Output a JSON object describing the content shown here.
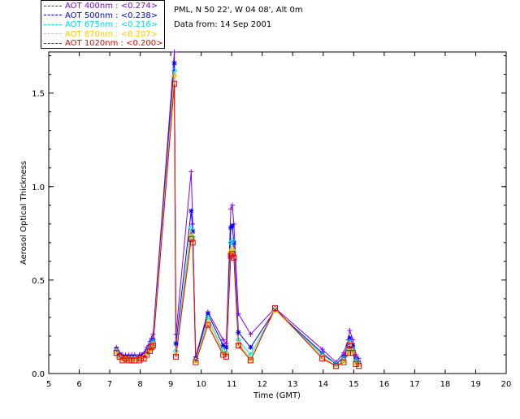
{
  "info": {
    "location": "PML, N 50 22', W 04 08', Alt 0m",
    "date": "Data from: 14 Sep 2001"
  },
  "chart_data": {
    "type": "line",
    "xlabel": "Time (GMT)",
    "ylabel": "Aerosol Optical Thickness",
    "xlim": [
      5,
      20
    ],
    "ylim": [
      0,
      1.72
    ],
    "xticks": [
      "5",
      "6",
      "7",
      "8",
      "9",
      "10",
      "11",
      "12",
      "13",
      "14",
      "15",
      "16",
      "17",
      "18",
      "19",
      "20"
    ],
    "yticks": [
      {
        "v": 0.0,
        "label": "0.0"
      },
      {
        "v": 0.5,
        "label": "0.5"
      },
      {
        "v": 1.0,
        "label": "1.0"
      },
      {
        "v": 1.5,
        "label": "1.5"
      }
    ],
    "x": [
      7.22,
      7.32,
      7.42,
      7.52,
      7.62,
      7.72,
      7.82,
      7.97,
      8.02,
      8.12,
      8.22,
      8.32,
      8.37,
      8.42,
      9.12,
      9.17,
      9.67,
      9.72,
      9.82,
      10.22,
      10.72,
      10.82,
      10.97,
      11.02,
      11.07,
      11.22,
      11.62,
      12.42,
      13.97,
      14.42,
      14.67,
      14.82,
      14.87,
      14.97,
      15.07,
      15.17
    ],
    "series": [
      {
        "name": "AOT  400nm : <0.274>",
        "color": "#7f00ff",
        "marker": "plus",
        "values": [
          0.14,
          0.11,
          0.1,
          0.1,
          0.1,
          0.1,
          0.1,
          0.1,
          0.1,
          0.11,
          0.14,
          0.17,
          0.19,
          0.21,
          1.72,
          0.21,
          1.08,
          0.8,
          0.09,
          0.33,
          0.18,
          0.16,
          0.88,
          0.9,
          0.8,
          0.32,
          0.21,
          0.35,
          0.13,
          0.06,
          0.11,
          0.18,
          0.23,
          0.18,
          0.1,
          0.08
        ]
      },
      {
        "name": "AOT  500nm : <0.238>",
        "color": "#0000ff",
        "marker": "star",
        "values": [
          0.13,
          0.1,
          0.09,
          0.09,
          0.09,
          0.09,
          0.09,
          0.09,
          0.09,
          0.1,
          0.12,
          0.15,
          0.17,
          0.18,
          1.66,
          0.16,
          0.87,
          0.76,
          0.08,
          0.32,
          0.15,
          0.14,
          0.78,
          0.79,
          0.7,
          0.22,
          0.14,
          0.34,
          0.11,
          0.05,
          0.09,
          0.15,
          0.19,
          0.15,
          0.08,
          0.06
        ]
      },
      {
        "name": "AOT  675nm : <0.216>",
        "color": "#00dcdc",
        "marker": "diamond",
        "values": [
          0.12,
          0.09,
          0.08,
          0.08,
          0.08,
          0.08,
          0.08,
          0.08,
          0.08,
          0.09,
          0.11,
          0.14,
          0.16,
          0.17,
          1.62,
          0.12,
          0.78,
          0.73,
          0.07,
          0.3,
          0.12,
          0.11,
          0.7,
          0.71,
          0.65,
          0.18,
          0.1,
          0.34,
          0.1,
          0.05,
          0.08,
          0.13,
          0.17,
          0.13,
          0.07,
          0.05
        ]
      },
      {
        "name": "AOT  870nm : <0.207>",
        "color": "#ffc800",
        "marker": "triangle",
        "values": [
          0.12,
          0.09,
          0.08,
          0.08,
          0.08,
          0.08,
          0.08,
          0.08,
          0.08,
          0.09,
          0.11,
          0.13,
          0.15,
          0.16,
          1.6,
          0.1,
          0.75,
          0.72,
          0.07,
          0.28,
          0.11,
          0.1,
          0.66,
          0.67,
          0.63,
          0.16,
          0.08,
          0.34,
          0.09,
          0.04,
          0.07,
          0.12,
          0.16,
          0.12,
          0.06,
          0.05
        ]
      },
      {
        "name": "AOT 1020nm : <0.200>",
        "color": "#e60000",
        "marker": "square",
        "values": [
          0.11,
          0.09,
          0.07,
          0.08,
          0.07,
          0.07,
          0.07,
          0.07,
          0.08,
          0.08,
          0.1,
          0.12,
          0.14,
          0.15,
          1.55,
          0.09,
          0.72,
          0.7,
          0.06,
          0.26,
          0.1,
          0.09,
          0.63,
          0.64,
          0.62,
          0.15,
          0.07,
          0.35,
          0.08,
          0.04,
          0.06,
          0.11,
          0.15,
          0.11,
          0.05,
          0.04
        ]
      }
    ]
  }
}
